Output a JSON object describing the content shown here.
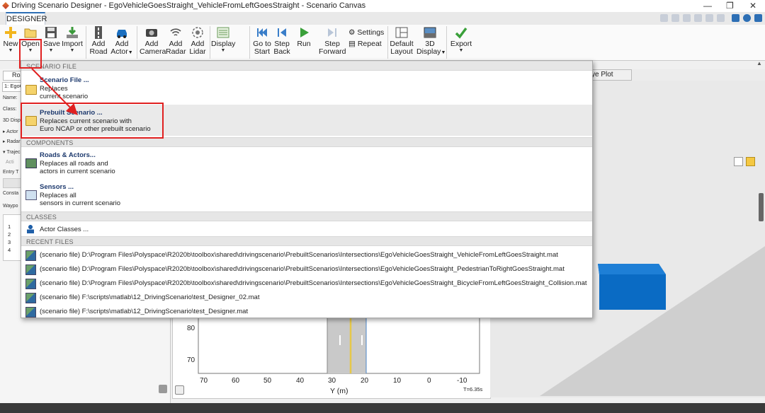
{
  "window": {
    "title": "Driving Scenario Designer - EgoVehicleGoesStraight_VehicleFromLeftGoesStraight - Scenario Canvas",
    "controls": [
      "—",
      "❐",
      "✕"
    ]
  },
  "tabs": {
    "designer": "DESIGNER"
  },
  "ribbon": {
    "new": "New",
    "open": "Open",
    "save": "Save",
    "import": "Import",
    "add_road": [
      "Add",
      "Road"
    ],
    "add_actor": [
      "Add",
      "Actor"
    ],
    "add_camera": [
      "Add",
      "Camera"
    ],
    "add_radar": [
      "Add",
      "Radar"
    ],
    "add_lidar": [
      "Add",
      "Lidar"
    ],
    "display": "Display",
    "goto_start": [
      "Go to",
      "Start"
    ],
    "step_back": [
      "Step",
      "Back"
    ],
    "run": "Run",
    "step_forward": [
      "Step",
      "Forward"
    ],
    "settings": "Settings",
    "repeat": "Repeat",
    "default_layout": [
      "Default",
      "Layout"
    ],
    "display_3d": [
      "3D",
      "Display"
    ],
    "export": "Export"
  },
  "left_panel": {
    "tab": "Roa",
    "select_value": "1: EgoC",
    "labels": [
      "Name:",
      "Class:",
      "3D Disp",
      "▸ Actor",
      "▸ Radar",
      "▾ Trajec",
      "Acti",
      "Entry T",
      "Consta",
      "Waypo"
    ],
    "rows": [
      "1",
      "2",
      "3",
      "4"
    ]
  },
  "right_panel": {
    "tab": "ye Plot"
  },
  "plot": {
    "y_ticks": [
      "80",
      "70"
    ],
    "x_ticks": [
      "70",
      "60",
      "50",
      "40",
      "30",
      "20",
      "10",
      "0",
      "-10"
    ],
    "xlabel": "Y (m)",
    "time": "T=6.35s"
  },
  "open_menu": {
    "scenario_file_header": "SCENARIO FILE",
    "scenario_file": {
      "title": "Scenario File ...",
      "desc": [
        "Replaces",
        "current scenario"
      ]
    },
    "prebuilt_scenario": {
      "title": "Prebuilt Scenario ...",
      "desc": [
        "Replaces current scenario with",
        "Euro NCAP or other prebuilt scenario"
      ]
    },
    "components_header": "COMPONENTS",
    "roads_actors": {
      "title": "Roads & Actors...",
      "desc": [
        "Replaces all roads and",
        "actors in current scenario"
      ]
    },
    "sensors": {
      "title": "Sensors ...",
      "desc": [
        "Replaces all",
        "sensors in current scenario"
      ]
    },
    "classes_header": "CLASSES",
    "actor_classes": "Actor Classes ...",
    "recent_header": "RECENT FILES",
    "recent_files": [
      "(scenario file) D:\\Program Files\\Polyspace\\R2020b\\toolbox\\shared\\drivingscenario\\PrebuiltScenarios\\Intersections\\EgoVehicleGoesStraight_VehicleFromLeftGoesStraight.mat",
      "(scenario file) D:\\Program Files\\Polyspace\\R2020b\\toolbox\\shared\\drivingscenario\\PrebuiltScenarios\\Intersections\\EgoVehicleGoesStraight_PedestrianToRightGoesStraight.mat",
      "(scenario file) D:\\Program Files\\Polyspace\\R2020b\\toolbox\\shared\\drivingscenario\\PrebuiltScenarios\\Intersections\\EgoVehicleGoesStraight_BicycleFromLeftGoesStraight_Collision.mat",
      "(scenario file) F:\\scripts\\matlab\\12_DrivingScenario\\test_Designer_02.mat",
      "(scenario file) F:\\scripts\\matlab\\12_DrivingScenario\\test_Designer.mat"
    ]
  },
  "colors": {
    "accent": "#2d6fb5",
    "highlight": "#e02020",
    "vehicle": "#0a6bc4"
  }
}
